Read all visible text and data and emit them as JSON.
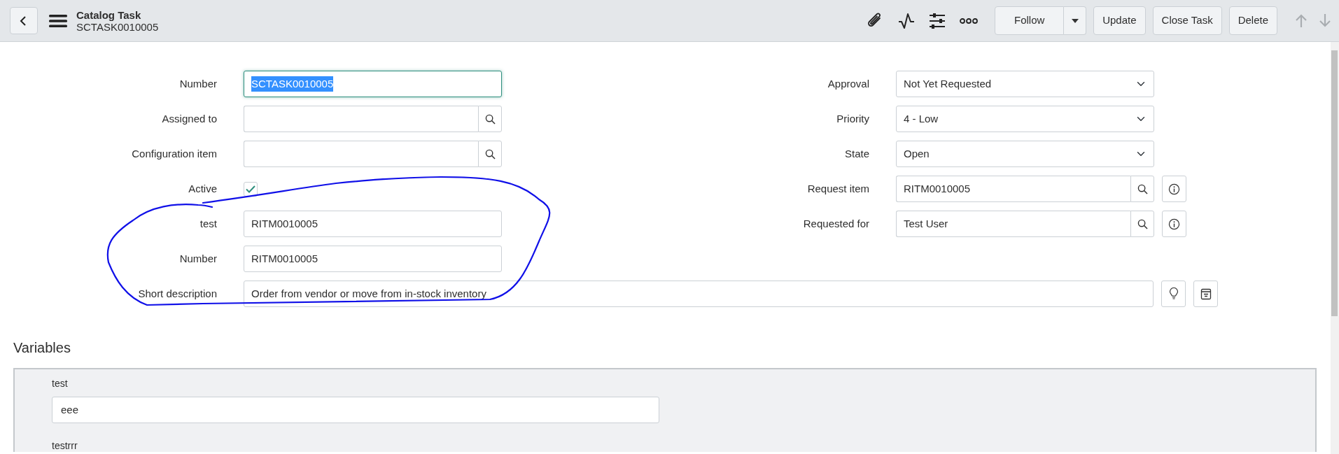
{
  "header": {
    "title": "Catalog Task",
    "subtitle": "SCTASK0010005",
    "buttons": [
      {
        "label": "Follow",
        "kind": "split"
      },
      {
        "label": "Update",
        "kind": "plain"
      },
      {
        "label": "Close Task",
        "kind": "plain"
      },
      {
        "label": "Delete",
        "kind": "plain"
      }
    ],
    "record_nav": [
      {
        "kind": "up",
        "disabled": true
      },
      {
        "kind": "down",
        "disabled": true
      }
    ]
  },
  "form": {
    "left": [
      {
        "label": "Number",
        "kind": "text",
        "value": "SCTASK0010005",
        "focused": true,
        "text_selected": true
      },
      {
        "label": "Assigned to",
        "kind": "reference"
      },
      {
        "label": "Configuration item",
        "kind": "reference"
      },
      {
        "label": "Active",
        "kind": "checkbox",
        "checked": true
      },
      {
        "label": "test",
        "kind": "text",
        "value": "RITM0010005",
        "focused": false,
        "text_selected": false
      },
      {
        "label": "Number",
        "kind": "text",
        "value": "RITM0010005",
        "focused": false,
        "text_selected": false
      }
    ],
    "right": [
      {
        "label": "Approval",
        "kind": "select",
        "value": "Not Yet Requested"
      },
      {
        "label": "Priority",
        "kind": "select",
        "value": "4 - Low"
      },
      {
        "label": "State",
        "kind": "select",
        "value": "Open"
      },
      {
        "label": "Request item",
        "kind": "reference",
        "value": "RITM0010005",
        "info": true
      },
      {
        "label": "Requested for",
        "kind": "reference",
        "value": "Test User",
        "info": true
      }
    ],
    "short_description": {
      "label": "Short description",
      "value": "Order from vendor or move from in-stock inventory"
    }
  },
  "variables": {
    "title": "Variables",
    "items": [
      {
        "label": "test",
        "value": "eee"
      },
      {
        "label": "testrrr"
      }
    ]
  }
}
